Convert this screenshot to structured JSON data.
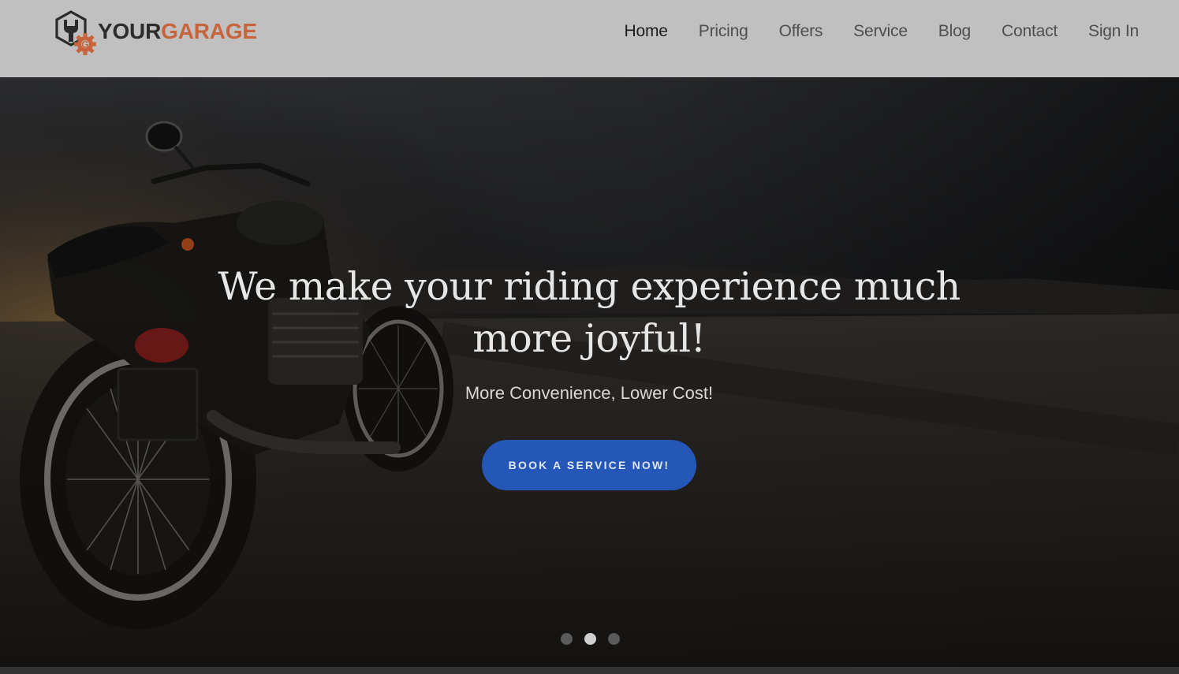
{
  "brand": {
    "part1": "YOUR",
    "part2": "GARAGE",
    "accent_color": "#c8643c",
    "dark_color": "#2c2c2c"
  },
  "nav": {
    "items": [
      {
        "label": "Home",
        "active": true
      },
      {
        "label": "Pricing",
        "active": false
      },
      {
        "label": "Offers",
        "active": false
      },
      {
        "label": "Service",
        "active": false
      },
      {
        "label": "Blog",
        "active": false
      },
      {
        "label": "Contact",
        "active": false
      },
      {
        "label": "Sign In",
        "active": false
      }
    ]
  },
  "hero": {
    "title": "We make your riding experience much more joyful!",
    "subtitle": "More Convenience, Lower Cost!",
    "cta_label": "BOOK A SERVICE NOW!",
    "cta_color": "#2457b8",
    "slides": {
      "count": 3,
      "active_index": 1
    }
  }
}
